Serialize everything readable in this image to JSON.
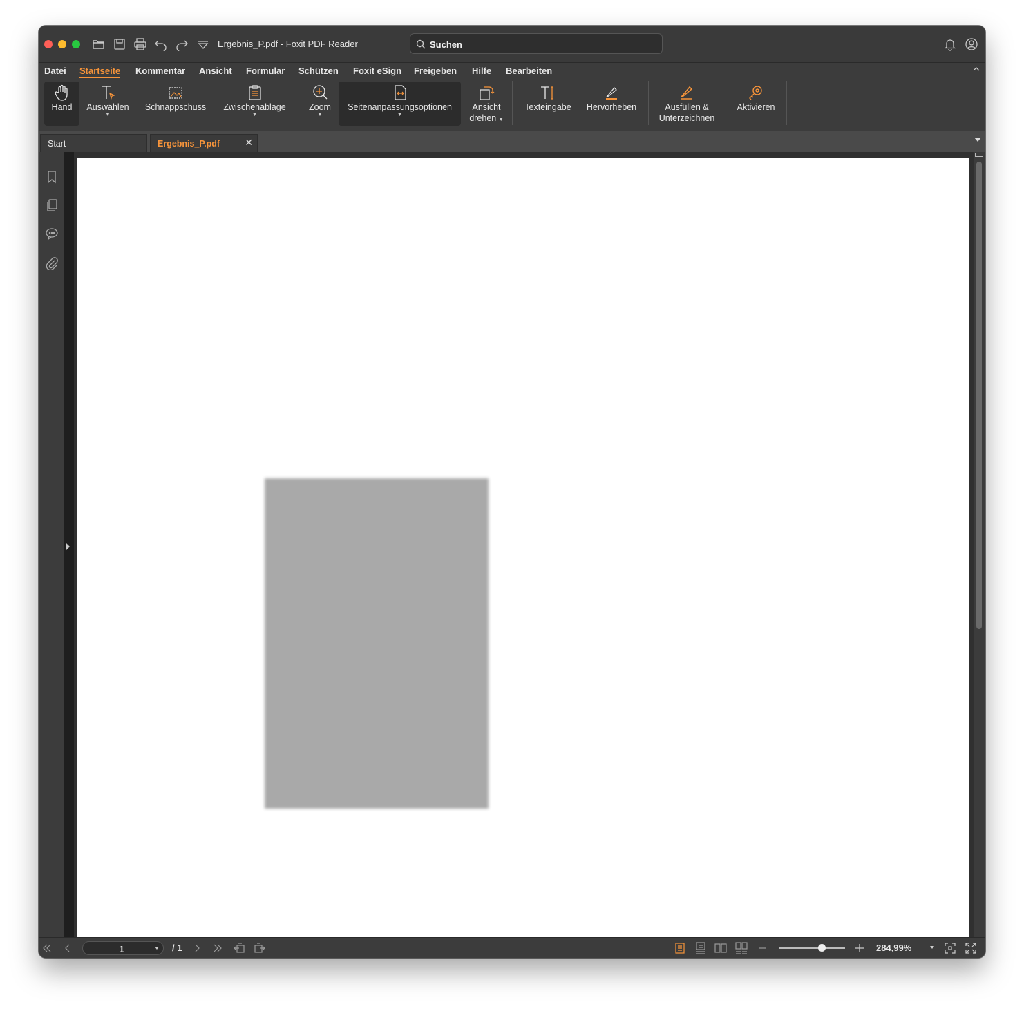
{
  "window": {
    "title": "Ergebnis_P.pdf - Foxit PDF Reader"
  },
  "search": {
    "placeholder": "Suchen"
  },
  "menu": {
    "items": [
      "Datei",
      "Startseite",
      "Kommentar",
      "Ansicht",
      "Formular",
      "Schützen",
      "Foxit eSign",
      "Freigeben",
      "Hilfe",
      "Bearbeiten"
    ],
    "active": "Startseite"
  },
  "ribbon": {
    "hand": "Hand",
    "select": "Auswählen",
    "snapshot": "Schnappschuss",
    "clipboard": "Zwischenablage",
    "zoom": "Zoom",
    "fit_options": "Seitenanpassungsoptionen",
    "rotate_line1": "Ansicht",
    "rotate_line2": "drehen",
    "typewriter": "Texteingabe",
    "highlight": "Hervorheben",
    "fill_sign_line1": "Ausfüllen &",
    "fill_sign_line2": "Unterzeichnen",
    "activate": "Aktivieren"
  },
  "tabs": {
    "start": "Start",
    "document": "Ergebnis_P.pdf",
    "close_glyph": "✕"
  },
  "statusbar": {
    "current_page": "1",
    "total_pages": "/ 1",
    "zoom": "284,99%"
  },
  "colors": {
    "accent": "#f7943a",
    "window_bg": "#3c3c3c",
    "page_bg": "#ffffff",
    "image_placeholder": "#a9a9a9"
  },
  "icons": [
    "folder-open-icon",
    "save-icon",
    "print-icon",
    "undo-icon",
    "redo-icon",
    "customize-dropdown-icon",
    "search-icon",
    "bell-icon",
    "account-icon",
    "hand-icon",
    "select-text-icon",
    "snapshot-icon",
    "clipboard-icon",
    "zoom-icon",
    "fit-page-icon",
    "rotate-view-icon",
    "typewriter-icon",
    "highlight-icon",
    "fill-sign-icon",
    "activate-key-icon",
    "bookmark-icon",
    "pages-icon",
    "comments-icon",
    "attachment-icon"
  ]
}
